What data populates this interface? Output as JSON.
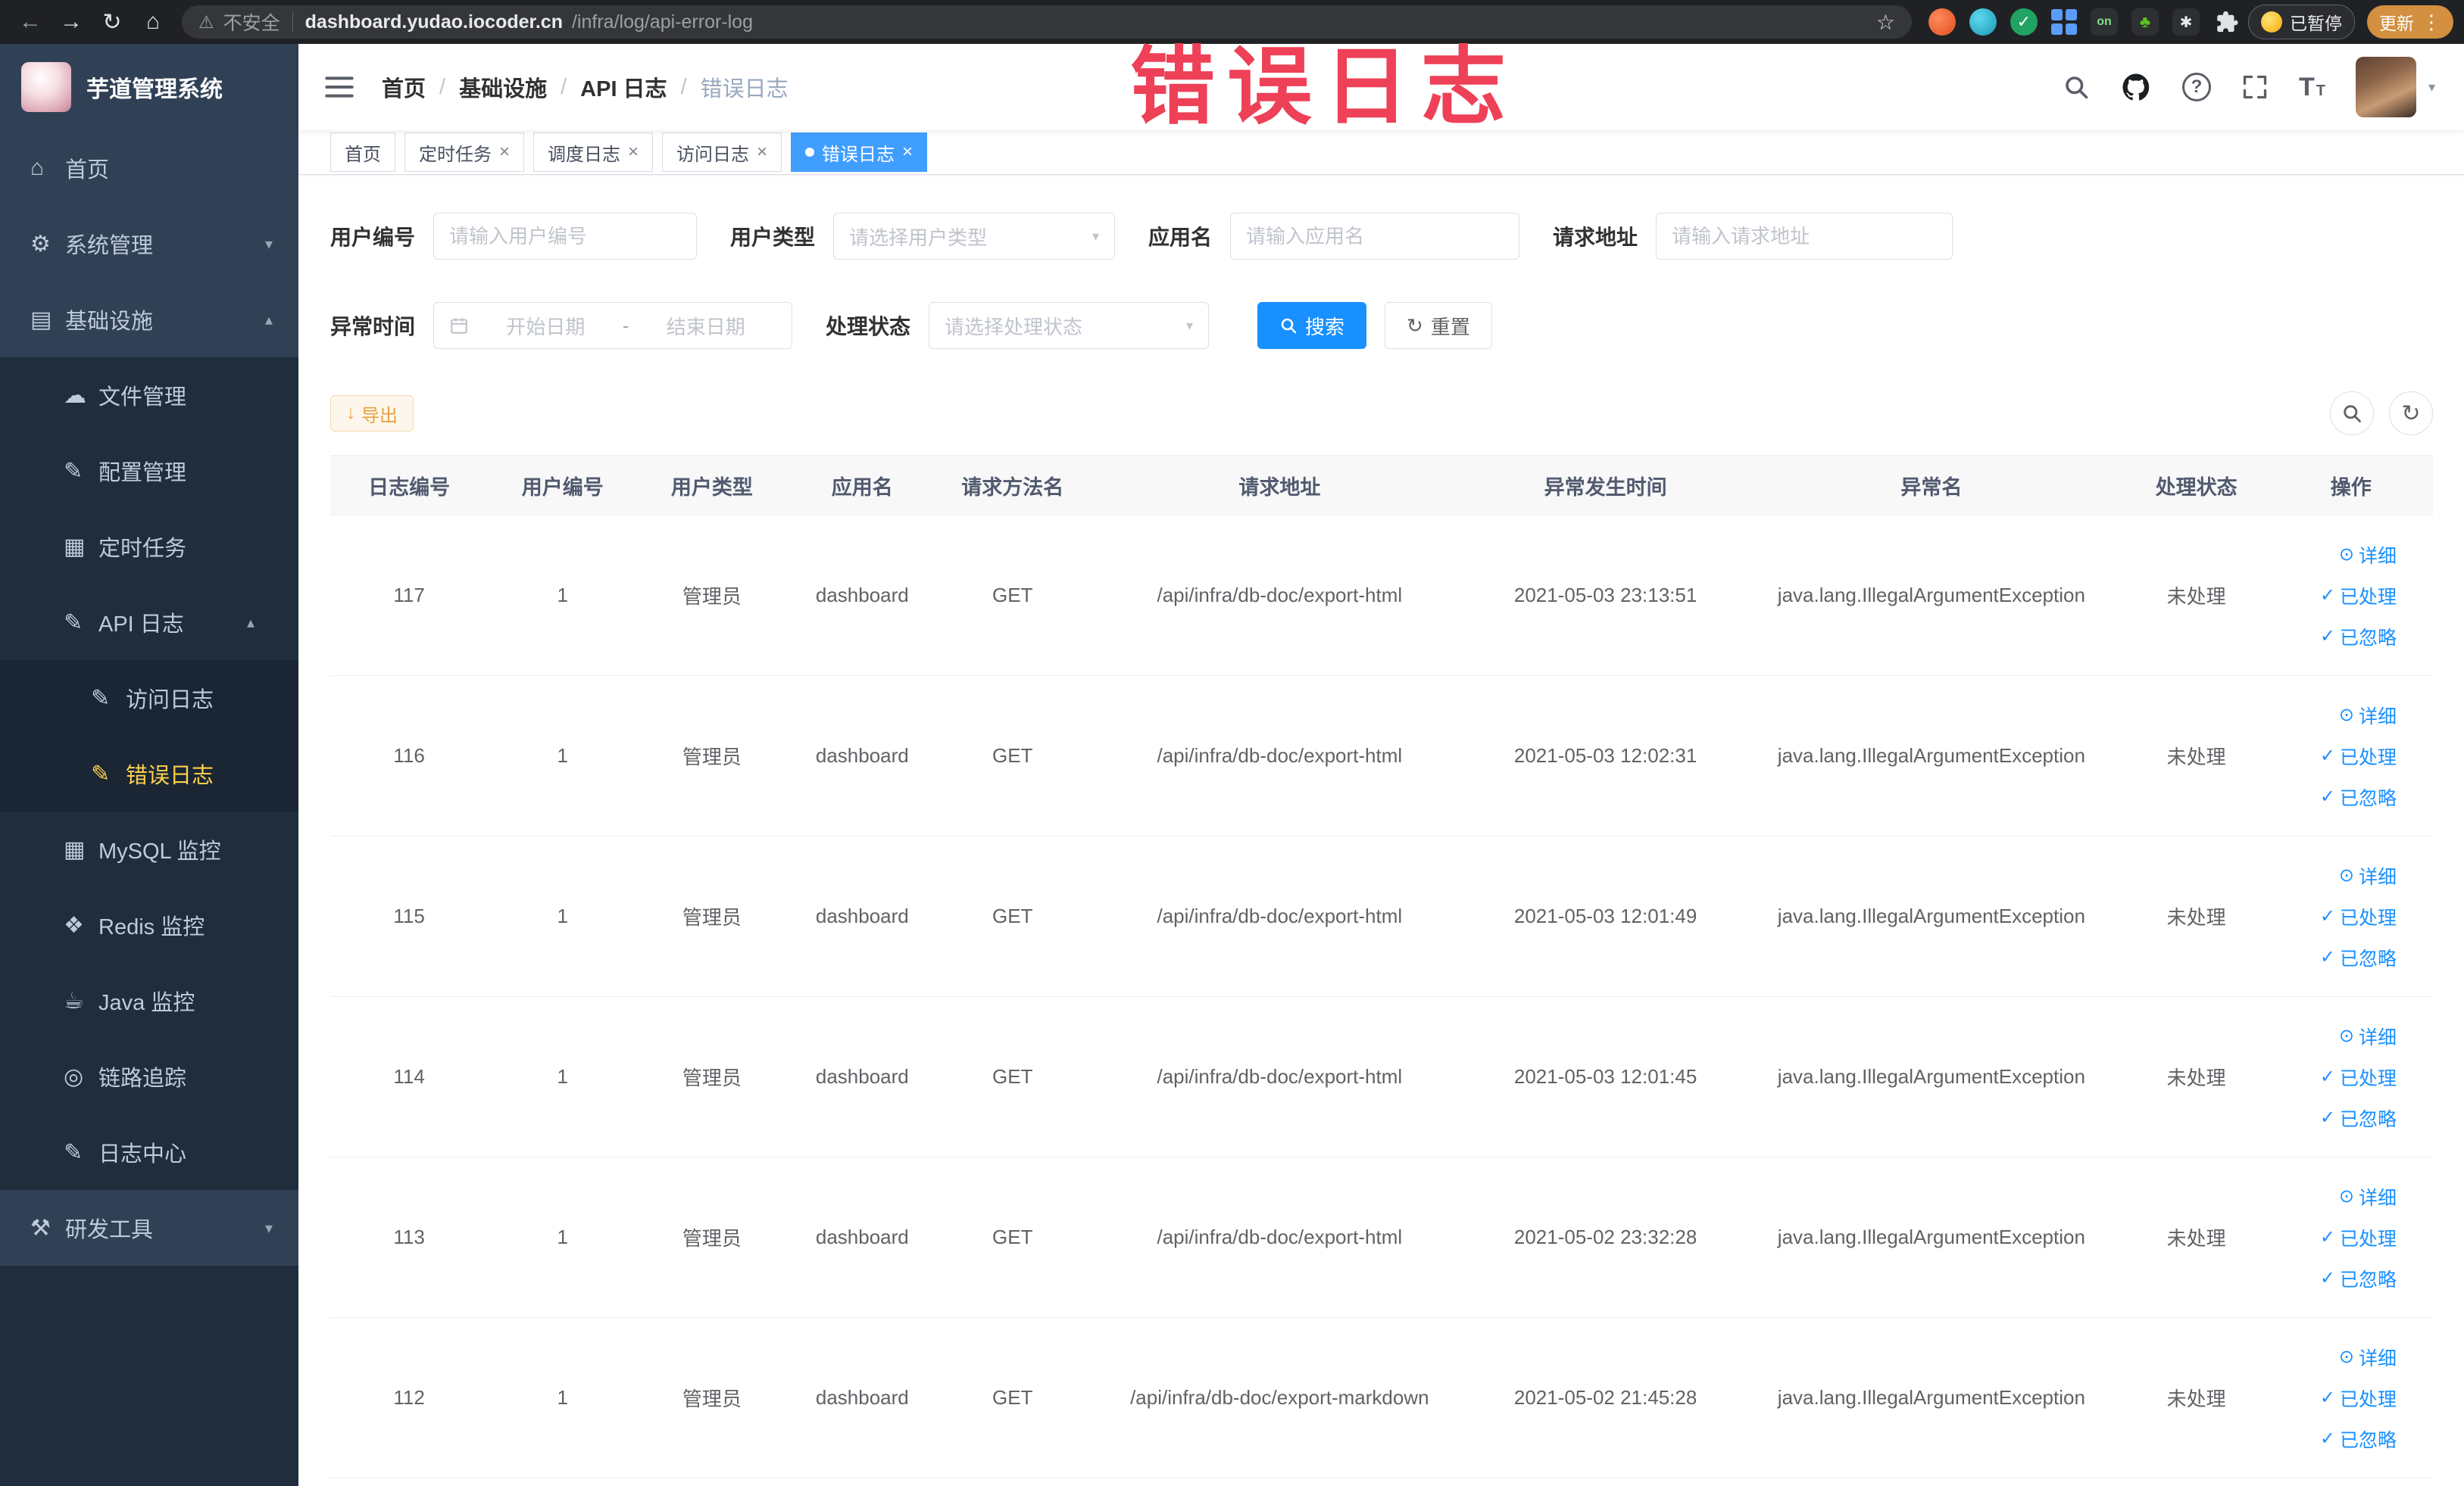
{
  "browser": {
    "security_label": "不安全",
    "url_domain": "dashboard.yudao.iocoder.cn",
    "url_path": "/infra/log/api-error-log",
    "paused_button": "已暂停",
    "update_button": "更新",
    "ext_on_label": "on"
  },
  "annotation": {
    "watermark": "错误日志"
  },
  "icons": {
    "back": "←",
    "forward": "→",
    "reload": "↻",
    "home_chrome": "⌂",
    "warning": "⚠",
    "star": "☆",
    "menu_dots": "⋮",
    "home": "⌂",
    "gear": "⚙",
    "infra": "▤",
    "cloud": "☁",
    "edit": "✎",
    "grid": "▦",
    "coins": "❖",
    "coffee": "☕",
    "trace": "◎",
    "tools": "⚒",
    "chevron_down": "▾",
    "chevron_up": "▴",
    "select_caret": "▾",
    "check": "✓",
    "eye": "⊙",
    "download": "↓",
    "refresh": "↻",
    "close": "×",
    "question": "?",
    "font_big": "T",
    "font_small": "T",
    "ext_check": "✓",
    "ext_clover": "♣",
    "ext_paw": "✱"
  },
  "sidebar": {
    "logo_title": "芋道管理系统",
    "items": [
      {
        "label": "首页"
      },
      {
        "label": "系统管理"
      },
      {
        "label": "基础设施"
      },
      {
        "label": "文件管理"
      },
      {
        "label": "配置管理"
      },
      {
        "label": "定时任务"
      },
      {
        "label": "API 日志"
      },
      {
        "label": "访问日志"
      },
      {
        "label": "错误日志"
      },
      {
        "label": "MySQL 监控"
      },
      {
        "label": "Redis 监控"
      },
      {
        "label": "Java 监控"
      },
      {
        "label": "链路追踪"
      },
      {
        "label": "日志中心"
      },
      {
        "label": "研发工具"
      }
    ]
  },
  "breadcrumb": {
    "separator": "/",
    "items": [
      "首页",
      "基础设施",
      "API 日志",
      "错误日志"
    ]
  },
  "tabs": [
    {
      "label": "首页"
    },
    {
      "label": "定时任务"
    },
    {
      "label": "调度日志"
    },
    {
      "label": "访问日志"
    },
    {
      "label": "错误日志"
    }
  ],
  "filters": {
    "user_id_label": "用户编号",
    "user_id_placeholder": "请输入用户编号",
    "user_type_label": "用户类型",
    "user_type_placeholder": "请选择用户类型",
    "app_name_label": "应用名",
    "app_name_placeholder": "请输入应用名",
    "request_url_label": "请求地址",
    "request_url_placeholder": "请输入请求地址",
    "exception_time_label": "异常时间",
    "start_date_placeholder": "开始日期",
    "date_separator": "-",
    "end_date_placeholder": "结束日期",
    "process_status_label": "处理状态",
    "process_status_placeholder": "请选择处理状态",
    "search_button": "搜索",
    "reset_button": "重置"
  },
  "toolbar": {
    "export_button": "导出"
  },
  "table": {
    "columns": [
      "日志编号",
      "用户编号",
      "用户类型",
      "应用名",
      "请求方法名",
      "请求地址",
      "异常发生时间",
      "异常名",
      "处理状态",
      "操作"
    ],
    "action_labels": {
      "detail": "详细",
      "processed": "已处理",
      "ignored": "已忽略"
    },
    "rows": [
      {
        "id": "117",
        "user_id": "1",
        "user_type": "管理员",
        "app": "dashboard",
        "method": "GET",
        "url": "/api/infra/db-doc/export-html",
        "time": "2021-05-03 23:13:51",
        "exception": "java.lang.IllegalArgumentException",
        "status": "未处理"
      },
      {
        "id": "116",
        "user_id": "1",
        "user_type": "管理员",
        "app": "dashboard",
        "method": "GET",
        "url": "/api/infra/db-doc/export-html",
        "time": "2021-05-03 12:02:31",
        "exception": "java.lang.IllegalArgumentException",
        "status": "未处理"
      },
      {
        "id": "115",
        "user_id": "1",
        "user_type": "管理员",
        "app": "dashboard",
        "method": "GET",
        "url": "/api/infra/db-doc/export-html",
        "time": "2021-05-03 12:01:49",
        "exception": "java.lang.IllegalArgumentException",
        "status": "未处理"
      },
      {
        "id": "114",
        "user_id": "1",
        "user_type": "管理员",
        "app": "dashboard",
        "method": "GET",
        "url": "/api/infra/db-doc/export-html",
        "time": "2021-05-03 12:01:45",
        "exception": "java.lang.IllegalArgumentException",
        "status": "未处理"
      },
      {
        "id": "113",
        "user_id": "1",
        "user_type": "管理员",
        "app": "dashboard",
        "method": "GET",
        "url": "/api/infra/db-doc/export-html",
        "time": "2021-05-02 23:32:28",
        "exception": "java.lang.IllegalArgumentException",
        "status": "未处理"
      },
      {
        "id": "112",
        "user_id": "1",
        "user_type": "管理员",
        "app": "dashboard",
        "method": "GET",
        "url": "/api/infra/db-doc/export-markdown",
        "time": "2021-05-02 21:45:28",
        "exception": "java.lang.IllegalArgumentException",
        "status": "未处理"
      }
    ]
  }
}
